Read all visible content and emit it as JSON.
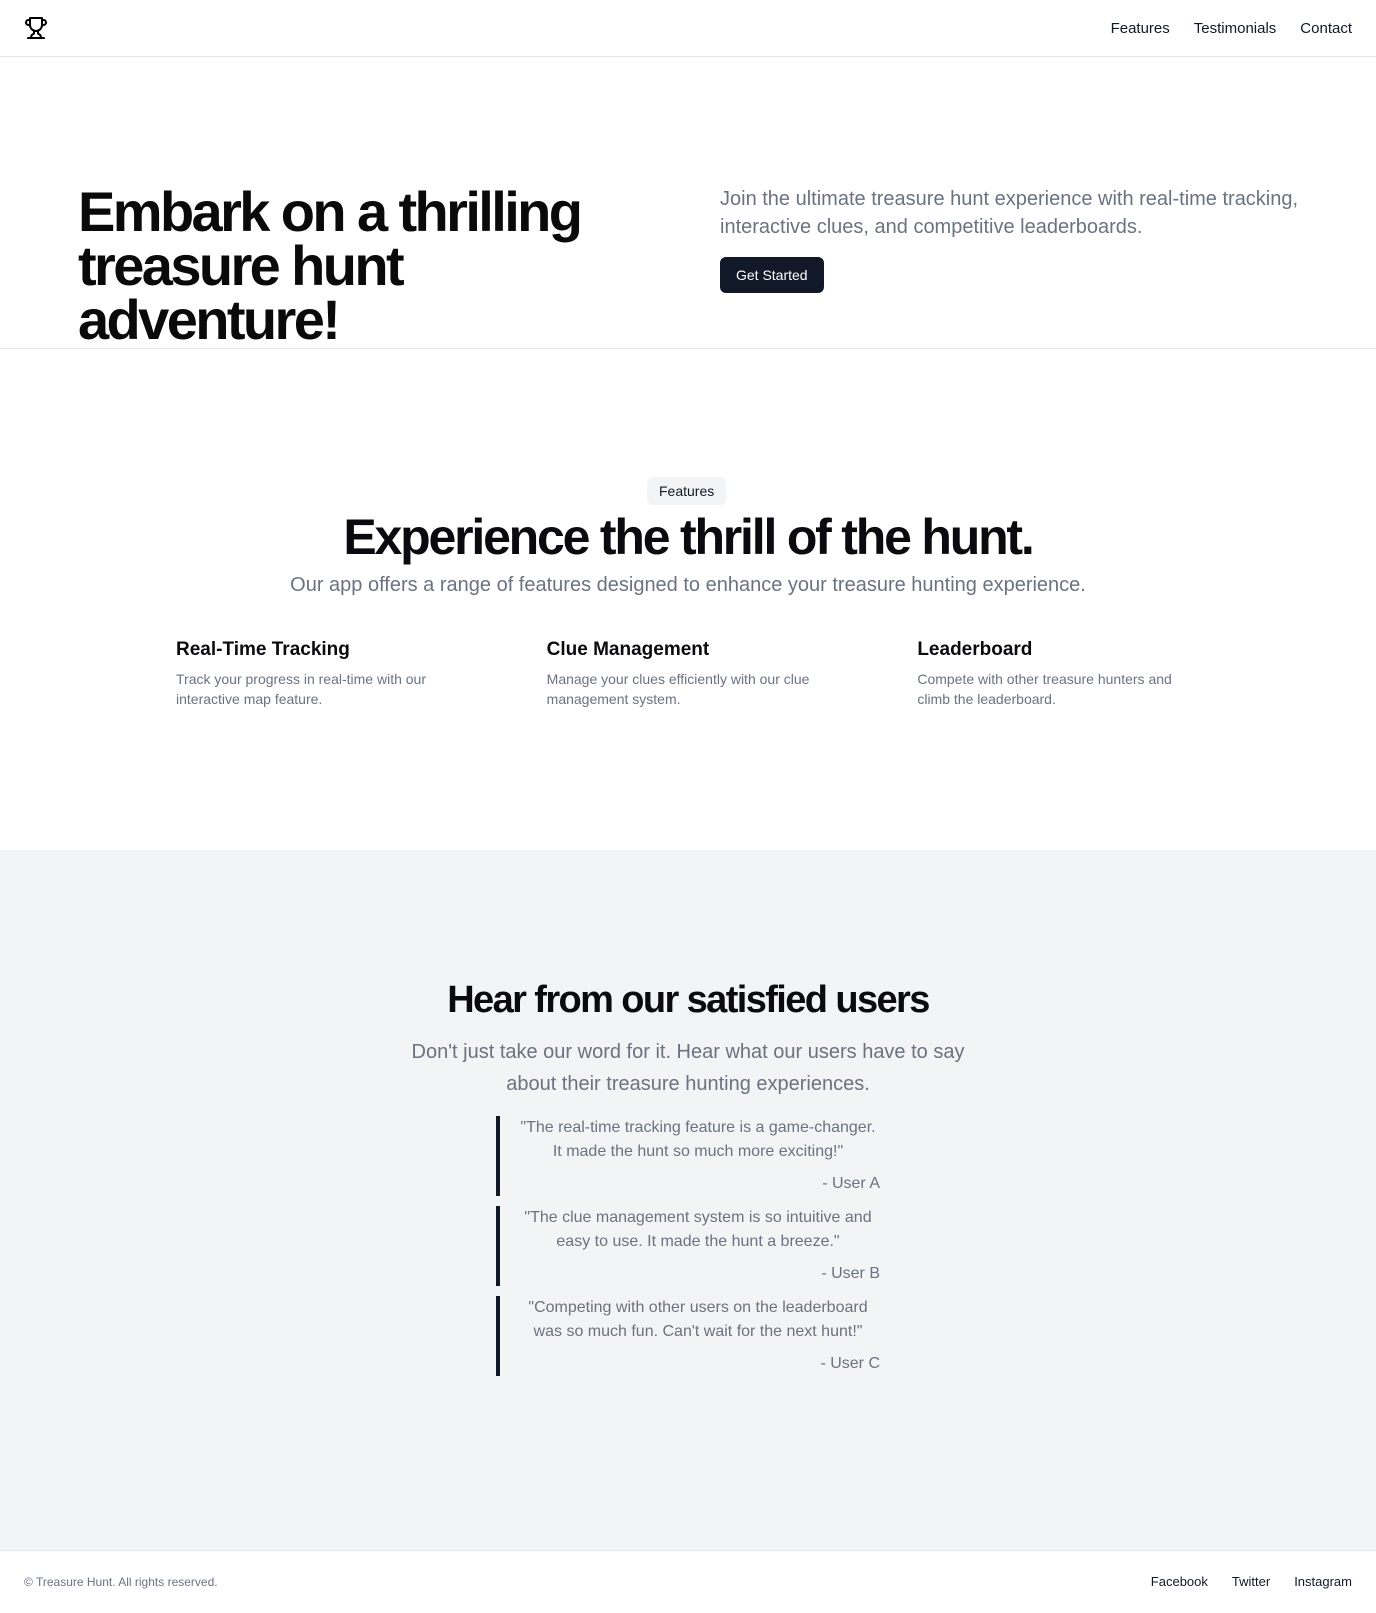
{
  "header": {
    "logo_icon": "trophy-icon",
    "nav": [
      {
        "label": "Features"
      },
      {
        "label": "Testimonials"
      },
      {
        "label": "Contact"
      }
    ]
  },
  "hero": {
    "title": "Embark on a thrilling treasure hunt adventure!",
    "description": "Join the ultimate treasure hunt experience with real-time tracking, interactive clues, and competitive leaderboards.",
    "cta_label": "Get Started"
  },
  "features": {
    "badge": "Features",
    "title": "Experience the thrill of the hunt.",
    "subtitle": "Our app offers a range of features designed to enhance your treasure hunting experience.",
    "items": [
      {
        "title": "Real-Time Tracking",
        "description": "Track your progress in real-time with our interactive map feature."
      },
      {
        "title": "Clue Management",
        "description": "Manage your clues efficiently with our clue management system."
      },
      {
        "title": "Leaderboard",
        "description": "Compete with other treasure hunters and climb the leaderboard."
      }
    ]
  },
  "testimonials": {
    "title": "Hear from our satisfied users",
    "subtitle": "Don't just take our word for it. Hear what our users have to say about their treasure hunting experiences.",
    "quotes": [
      {
        "text": "\"The real-time tracking feature is a game-changer. It made the hunt so much more exciting!\"",
        "author": "- User A"
      },
      {
        "text": "\"The clue management system is so intuitive and easy to use. It made the hunt a breeze.\"",
        "author": "- User B"
      },
      {
        "text": "\"Competing with other users on the leaderboard was so much fun. Can't wait for the next hunt!\"",
        "author": "- User C"
      }
    ]
  },
  "footer": {
    "copyright": "© Treasure Hunt. All rights reserved.",
    "links": [
      {
        "label": "Facebook"
      },
      {
        "label": "Twitter"
      },
      {
        "label": "Instagram"
      }
    ]
  },
  "colors": {
    "primary": "#111827",
    "muted_text": "#6b7280",
    "section_bg": "#f3f4f6",
    "border": "#e5e7eb"
  }
}
